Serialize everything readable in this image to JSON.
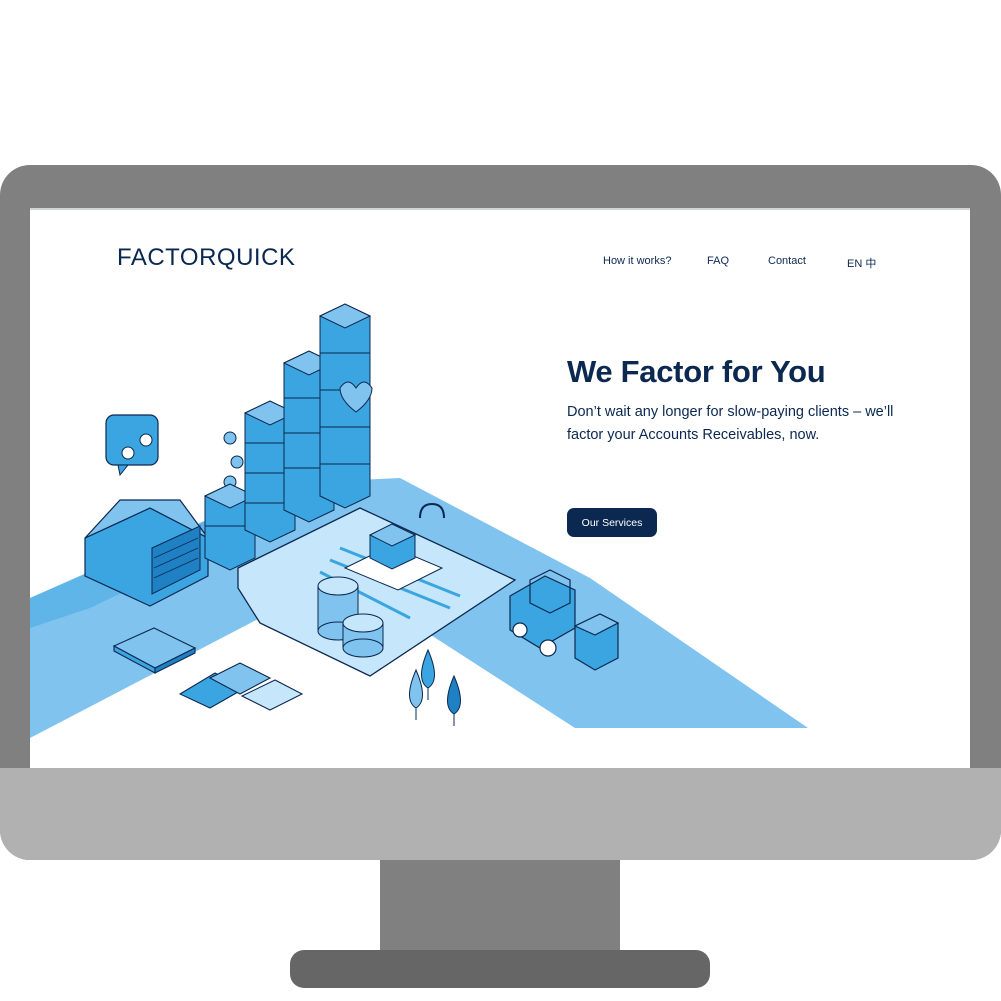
{
  "brand": {
    "name": "FACTORQUICK"
  },
  "nav": {
    "how_it_works": "How it works?",
    "faq": "FAQ",
    "contact": "Contact",
    "language": "EN 中"
  },
  "hero": {
    "title": "We Factor for You",
    "subtitle": "Don’t wait any longer for slow-paying clients – we’ll factor your Accounts Receivables, now.",
    "cta_label": "Our Services"
  },
  "colors": {
    "navy": "#0b2850",
    "light_blue": "#7fc3ee",
    "mid_blue": "#3aa5e0",
    "bezel": "#808080"
  },
  "illustration": {
    "icons": [
      "warehouse-icon",
      "box-stack-icon",
      "coin-stack-icon",
      "forklift-icon",
      "calculator-icon",
      "puzzle-icon",
      "tree-icon",
      "chat-bubble-icon"
    ]
  }
}
